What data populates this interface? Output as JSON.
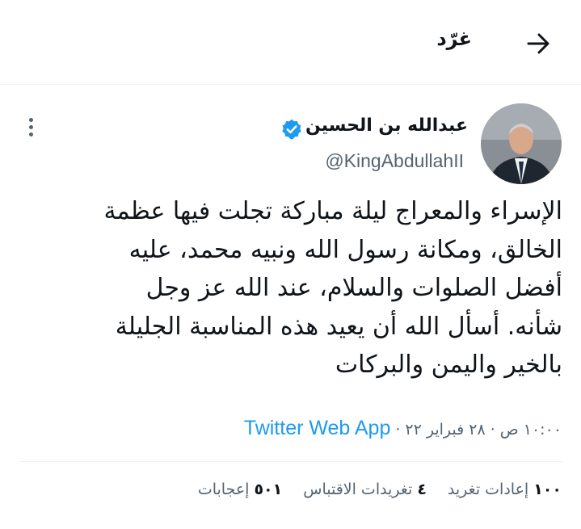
{
  "header": {
    "title": "غرّد"
  },
  "tweet": {
    "author": {
      "display_name": "عبدالله بن الحسين",
      "handle": "@KingAbdullahII",
      "verified": true
    },
    "text_lines": [
      "الإسراء والمعراج ليلة مباركة تجلت فيها عظمة",
      "الخالق، ومكانة رسول الله ونبيه محمد، عليه",
      "أفضل الصلوات والسلام، عند الله عز وجل",
      "شأنه. أسأل الله أن يعيد هذه المناسبة الجليلة",
      "بالخير واليمن والبركات"
    ],
    "time": "١٠:٠٠ ص",
    "separator": "·",
    "date": "٢٨ فبراير ٢٢",
    "source_app": "Twitter Web App",
    "stats": [
      {
        "count": "١٠٠",
        "label": "إعادات تغريد"
      },
      {
        "count": "٤",
        "label": "تغريدات الاقتباس"
      },
      {
        "count": "٥٠١",
        "label": "إعجابات"
      }
    ]
  },
  "colors": {
    "accent": "#1d9bf0",
    "secondary_text": "#536471",
    "primary_text": "#0f1419",
    "divider": "#eff3f4"
  },
  "icons": {
    "back": "arrow-right-icon",
    "verified": "verified-badge-icon",
    "more": "more-vertical-icon"
  }
}
